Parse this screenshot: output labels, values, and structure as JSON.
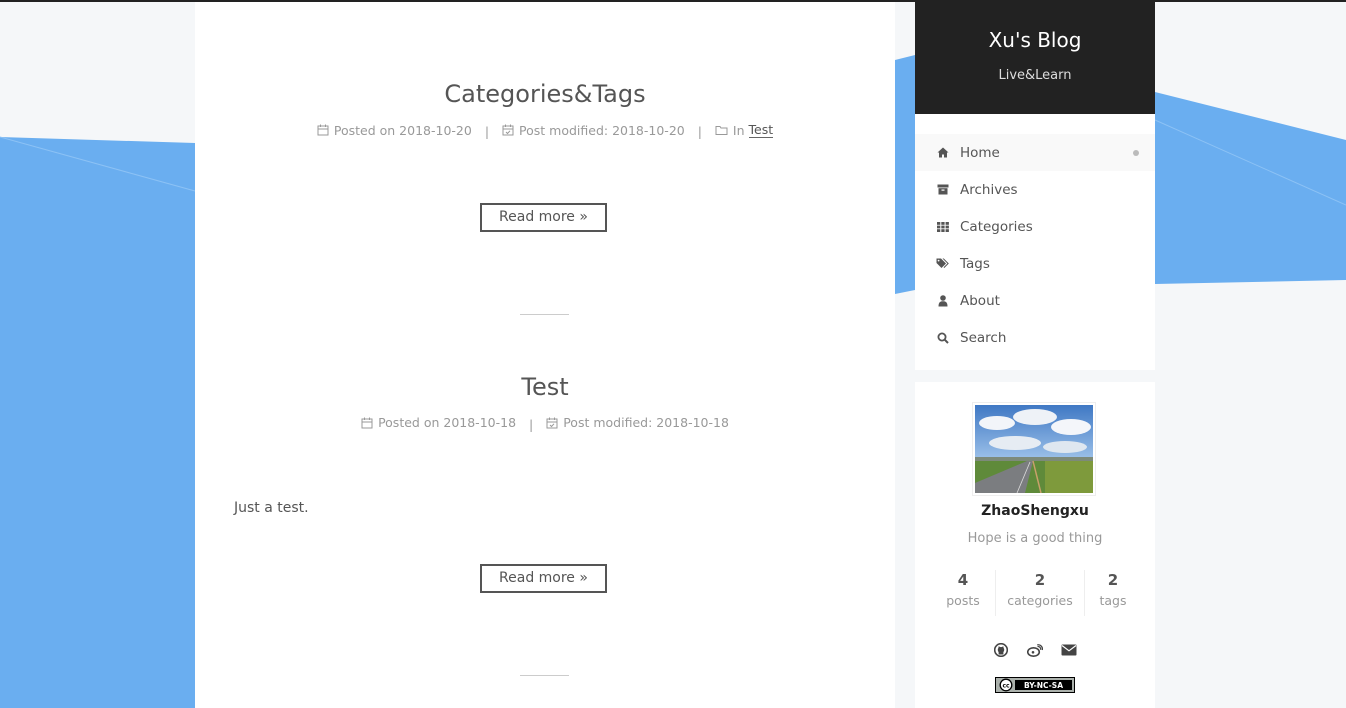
{
  "site": {
    "title": "Xu's Blog",
    "subtitle": "Live&Learn"
  },
  "menu": {
    "items": [
      {
        "label": "Home",
        "icon": "home-icon",
        "active": true
      },
      {
        "label": "Archives",
        "icon": "archive-icon"
      },
      {
        "label": "Categories",
        "icon": "th-icon"
      },
      {
        "label": "Tags",
        "icon": "tags-icon"
      },
      {
        "label": "About",
        "icon": "user-icon"
      },
      {
        "label": "Search",
        "icon": "search-icon"
      }
    ]
  },
  "posts": [
    {
      "title": "Categories&Tags",
      "posted_label": "Posted on",
      "posted_date": "2018-10-20",
      "modified_label": "Post modified:",
      "modified_date": "2018-10-20",
      "category_prefix": "In",
      "category": "Test",
      "read_more": "Read more »"
    },
    {
      "title": "Test",
      "posted_label": "Posted on",
      "posted_date": "2018-10-18",
      "modified_label": "Post modified:",
      "modified_date": "2018-10-18",
      "excerpt": "Just a test.",
      "read_more": "Read more »"
    }
  ],
  "author": {
    "name": "ZhaoShengxu",
    "description": "Hope is a good thing",
    "stats": [
      {
        "count": "4",
        "label": "posts"
      },
      {
        "count": "2",
        "label": "categories"
      },
      {
        "count": "2",
        "label": "tags"
      }
    ],
    "social_icons": [
      "github-icon",
      "weibo-icon",
      "email-icon"
    ],
    "license": "BY-NC-SA"
  },
  "colors": {
    "accent_blue": "#6aaef0",
    "header_bg": "#222222",
    "text": "#555555",
    "muted": "#999999"
  }
}
